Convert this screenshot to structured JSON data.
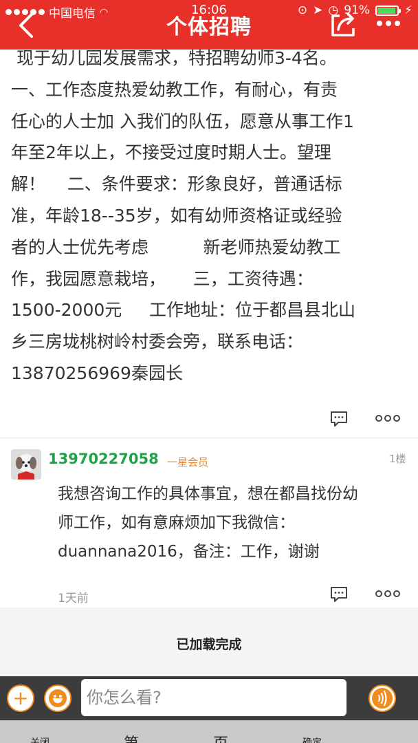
{
  "status_bar": {
    "carrier": "中国电信",
    "time": "16:06",
    "battery": "91%",
    "battery_level": 0.91,
    "battery_color": "#4cd964"
  },
  "header": {
    "title": "个体招聘",
    "back_icon": "back-chevron-icon",
    "share_icon": "share-icon",
    "more_icon": "more-dots-icon",
    "background_color": "#e8302b"
  },
  "post": {
    "body": " 现于幼儿园发展需求，特招聘幼师3-4名。\n一、工作态度热爱幼教工作，有耐心，有责\n任心的人士加 入我们的队伍，愿意从事工作1\n年至2年以上，不接受过度时期人士。望理\n解！    二、条件要求：形象良好，普通话标\n准，年龄18--35岁，如有幼师资格证或经验\n者的人士优先考虑          新老师热爱幼教工\n作，我园愿意栽培，     三，工资待遇：\n1500-2000元     工作地址：位于都昌县北山\n乡三房垅桃树岭村委会旁，联系电话：\n13870256969秦园长"
  },
  "comment": {
    "username": "13970227058",
    "member_level": "一星会员",
    "floor": "1楼",
    "text": "我想咨询工作的具体事宜，想在都昌找份幼\n师工作，如有意麻烦加下我微信：\nduannana2016，备注：工作，谢谢",
    "time": "1天前",
    "username_color": "#1fa349",
    "badge_color": "#e8862a"
  },
  "load_status": "已加载完成",
  "input_bar": {
    "placeholder": "你怎么看?",
    "accent_color": "#f28c1e"
  },
  "pager": {
    "close": "关闭",
    "di": "第",
    "ye": "页",
    "confirm": "确定"
  }
}
